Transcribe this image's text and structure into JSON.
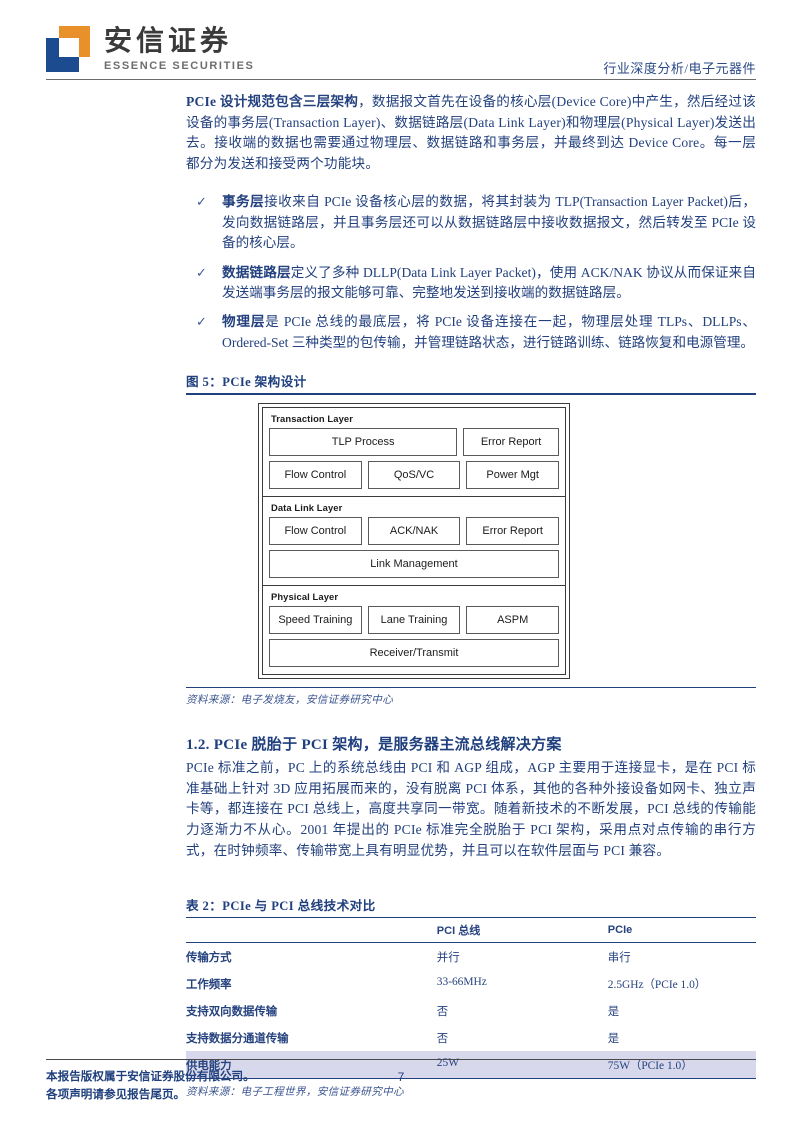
{
  "header": {
    "logo_cn": "安信证券",
    "logo_en": "ESSENCE SECURITIES",
    "breadcrumb": "行业深度分析/电子元器件"
  },
  "intro_paragraph": "PCIe 设计规范包含三层架构，数据报文首先在设备的核心层(Device Core)中产生，然后经过该设备的事务层(Transaction Layer)、数据链路层(Data Link Layer)和物理层(Physical Layer)发送出去。接收端的数据也需要通过物理层、数据链路和事务层，并最终到达 Device Core。每一层都分为发送和接受两个功能块。",
  "intro_lead": "PCIe 设计规范包含三层架构",
  "bullets": [
    {
      "marker": "✓",
      "lead": "事务层",
      "text": "接收来自 PCIe 设备核心层的数据，将其封装为 TLP(Transaction Layer Packet)后，发向数据链路层，并且事务层还可以从数据链路层中接收数据报文，然后转发至 PCIe 设备的核心层。"
    },
    {
      "marker": "✓",
      "lead": "数据链路层",
      "text": "定义了多种 DLLP(Data Link Layer Packet)，使用 ACK/NAK 协议从而保证来自发送端事务层的报文能够可靠、完整地发送到接收端的数据链路层。"
    },
    {
      "marker": "✓",
      "lead": "物理层",
      "text": "是 PCIe 总线的最底层，将 PCIe 设备连接在一起，物理层处理 TLPs、DLLPs、Ordered-Set 三种类型的包传输，并管理链路状态，进行链路训练、链路恢复和电源管理。"
    }
  ],
  "figure": {
    "caption": "图 5：PCIe 架构设计",
    "source": "资料来源：电子发烧友，安信证券研究中心",
    "layers": [
      {
        "title": "Transaction Layer",
        "rows": [
          [
            "TLP Process",
            "Error Report"
          ],
          [
            "Flow Control",
            "QoS/VC",
            "Power Mgt"
          ]
        ]
      },
      {
        "title": "Data Link Layer",
        "rows": [
          [
            "Flow Control",
            "ACK/NAK",
            "Error Report"
          ],
          [
            "Link Management"
          ]
        ]
      },
      {
        "title": "Physical Layer",
        "rows": [
          [
            "Speed Training",
            "Lane Training",
            "ASPM"
          ],
          [
            "Receiver/Transmit"
          ]
        ]
      }
    ]
  },
  "section": {
    "title": "1.2. PCIe 脱胎于 PCI 架构，是服务器主流总线解决方案",
    "paragraph": "PCIe 标准之前，PC 上的系统总线由 PCI 和 AGP 组成，AGP 主要用于连接显卡，是在 PCI 标准基础上针对 3D 应用拓展而来的，没有脱离 PCI 体系，其他的各种外接设备如网卡、独立声卡等，都连接在 PCI 总线上，高度共享同一带宽。随着新技术的不断发展，PCI 总线的传输能力逐渐力不从心。2001 年提出的 PCIe 标准完全脱胎于 PCI 架构，采用点对点传输的串行方式，在时钟频率、传输带宽上具有明显优势，并且可以在软件层面与 PCI 兼容。"
  },
  "table": {
    "caption": "表 2：PCIe 与 PCI 总线技术对比",
    "headers": [
      "",
      "PCI 总线",
      "PCIe"
    ],
    "rows": [
      {
        "label": "传输方式",
        "pci": "并行",
        "pcie": "串行",
        "highlight": false
      },
      {
        "label": "工作频率",
        "pci": "33-66MHz",
        "pcie": "2.5GHz（PCIe 1.0）",
        "highlight": false
      },
      {
        "label": "支持双向数据传输",
        "pci": "否",
        "pcie": "是",
        "highlight": false
      },
      {
        "label": "支持数据分通道传输",
        "pci": "否",
        "pcie": "是",
        "highlight": false
      },
      {
        "label": "供电能力",
        "pci": "25W",
        "pcie": "75W（PCIe 1.0）",
        "highlight": true
      }
    ],
    "source": "资料来源：电子工程世界，安信证券研究中心"
  },
  "footer": {
    "line1": "本报告版权属于安信证券股份有限公司。",
    "line2": "各项声明请参见报告尾页。",
    "page_number": "7"
  },
  "colors": {
    "brand_blue": "#1c4b8f",
    "brand_orange": "#e8912a",
    "text_blue": "#23417e",
    "rule_blue": "#21407e",
    "highlight_row": "#d8d8ec"
  }
}
